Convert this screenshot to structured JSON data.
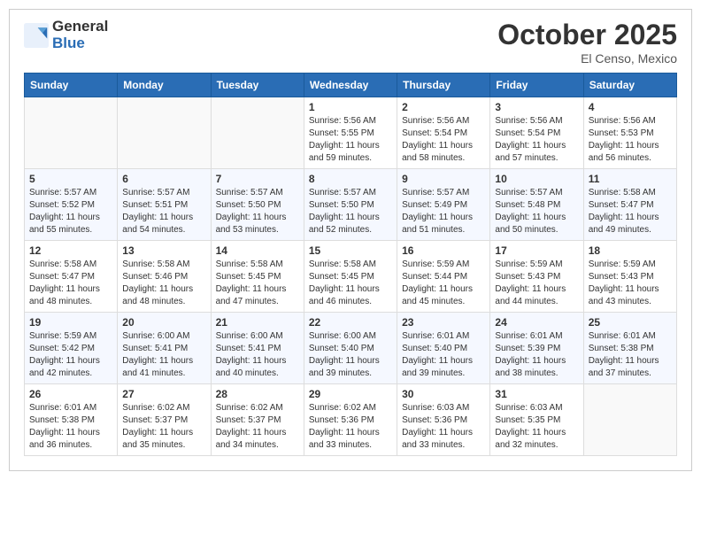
{
  "header": {
    "logo_general": "General",
    "logo_blue": "Blue",
    "month": "October 2025",
    "location": "El Censo, Mexico"
  },
  "weekdays": [
    "Sunday",
    "Monday",
    "Tuesday",
    "Wednesday",
    "Thursday",
    "Friday",
    "Saturday"
  ],
  "weeks": [
    [
      {
        "day": "",
        "info": ""
      },
      {
        "day": "",
        "info": ""
      },
      {
        "day": "",
        "info": ""
      },
      {
        "day": "1",
        "info": "Sunrise: 5:56 AM\nSunset: 5:55 PM\nDaylight: 11 hours and 59 minutes."
      },
      {
        "day": "2",
        "info": "Sunrise: 5:56 AM\nSunset: 5:54 PM\nDaylight: 11 hours and 58 minutes."
      },
      {
        "day": "3",
        "info": "Sunrise: 5:56 AM\nSunset: 5:54 PM\nDaylight: 11 hours and 57 minutes."
      },
      {
        "day": "4",
        "info": "Sunrise: 5:56 AM\nSunset: 5:53 PM\nDaylight: 11 hours and 56 minutes."
      }
    ],
    [
      {
        "day": "5",
        "info": "Sunrise: 5:57 AM\nSunset: 5:52 PM\nDaylight: 11 hours and 55 minutes."
      },
      {
        "day": "6",
        "info": "Sunrise: 5:57 AM\nSunset: 5:51 PM\nDaylight: 11 hours and 54 minutes."
      },
      {
        "day": "7",
        "info": "Sunrise: 5:57 AM\nSunset: 5:50 PM\nDaylight: 11 hours and 53 minutes."
      },
      {
        "day": "8",
        "info": "Sunrise: 5:57 AM\nSunset: 5:50 PM\nDaylight: 11 hours and 52 minutes."
      },
      {
        "day": "9",
        "info": "Sunrise: 5:57 AM\nSunset: 5:49 PM\nDaylight: 11 hours and 51 minutes."
      },
      {
        "day": "10",
        "info": "Sunrise: 5:57 AM\nSunset: 5:48 PM\nDaylight: 11 hours and 50 minutes."
      },
      {
        "day": "11",
        "info": "Sunrise: 5:58 AM\nSunset: 5:47 PM\nDaylight: 11 hours and 49 minutes."
      }
    ],
    [
      {
        "day": "12",
        "info": "Sunrise: 5:58 AM\nSunset: 5:47 PM\nDaylight: 11 hours and 48 minutes."
      },
      {
        "day": "13",
        "info": "Sunrise: 5:58 AM\nSunset: 5:46 PM\nDaylight: 11 hours and 48 minutes."
      },
      {
        "day": "14",
        "info": "Sunrise: 5:58 AM\nSunset: 5:45 PM\nDaylight: 11 hours and 47 minutes."
      },
      {
        "day": "15",
        "info": "Sunrise: 5:58 AM\nSunset: 5:45 PM\nDaylight: 11 hours and 46 minutes."
      },
      {
        "day": "16",
        "info": "Sunrise: 5:59 AM\nSunset: 5:44 PM\nDaylight: 11 hours and 45 minutes."
      },
      {
        "day": "17",
        "info": "Sunrise: 5:59 AM\nSunset: 5:43 PM\nDaylight: 11 hours and 44 minutes."
      },
      {
        "day": "18",
        "info": "Sunrise: 5:59 AM\nSunset: 5:43 PM\nDaylight: 11 hours and 43 minutes."
      }
    ],
    [
      {
        "day": "19",
        "info": "Sunrise: 5:59 AM\nSunset: 5:42 PM\nDaylight: 11 hours and 42 minutes."
      },
      {
        "day": "20",
        "info": "Sunrise: 6:00 AM\nSunset: 5:41 PM\nDaylight: 11 hours and 41 minutes."
      },
      {
        "day": "21",
        "info": "Sunrise: 6:00 AM\nSunset: 5:41 PM\nDaylight: 11 hours and 40 minutes."
      },
      {
        "day": "22",
        "info": "Sunrise: 6:00 AM\nSunset: 5:40 PM\nDaylight: 11 hours and 39 minutes."
      },
      {
        "day": "23",
        "info": "Sunrise: 6:01 AM\nSunset: 5:40 PM\nDaylight: 11 hours and 39 minutes."
      },
      {
        "day": "24",
        "info": "Sunrise: 6:01 AM\nSunset: 5:39 PM\nDaylight: 11 hours and 38 minutes."
      },
      {
        "day": "25",
        "info": "Sunrise: 6:01 AM\nSunset: 5:38 PM\nDaylight: 11 hours and 37 minutes."
      }
    ],
    [
      {
        "day": "26",
        "info": "Sunrise: 6:01 AM\nSunset: 5:38 PM\nDaylight: 11 hours and 36 minutes."
      },
      {
        "day": "27",
        "info": "Sunrise: 6:02 AM\nSunset: 5:37 PM\nDaylight: 11 hours and 35 minutes."
      },
      {
        "day": "28",
        "info": "Sunrise: 6:02 AM\nSunset: 5:37 PM\nDaylight: 11 hours and 34 minutes."
      },
      {
        "day": "29",
        "info": "Sunrise: 6:02 AM\nSunset: 5:36 PM\nDaylight: 11 hours and 33 minutes."
      },
      {
        "day": "30",
        "info": "Sunrise: 6:03 AM\nSunset: 5:36 PM\nDaylight: 11 hours and 33 minutes."
      },
      {
        "day": "31",
        "info": "Sunrise: 6:03 AM\nSunset: 5:35 PM\nDaylight: 11 hours and 32 minutes."
      },
      {
        "day": "",
        "info": ""
      }
    ]
  ],
  "colors": {
    "header_bg": "#2a6db5",
    "header_text": "#ffffff",
    "accent": "#2a6db5"
  }
}
